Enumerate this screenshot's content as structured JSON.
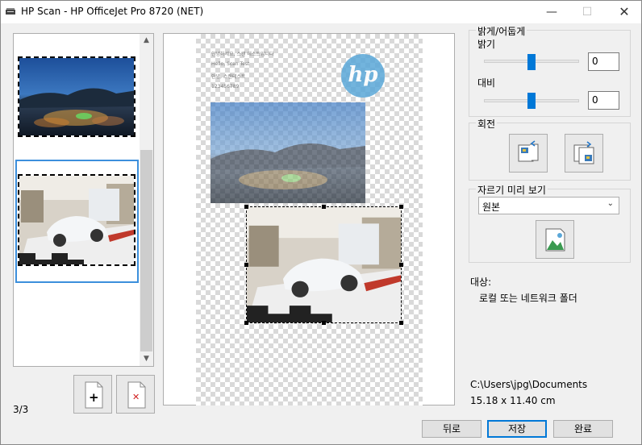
{
  "window": {
    "title": "HP Scan - HP OfficeJet Pro 8720 (NET)",
    "controls": {
      "minimize": "—",
      "maximize": "☐",
      "close": "✕"
    }
  },
  "thumbnails": {
    "items": [
      {
        "label": "night city landscape scan",
        "selected": false
      },
      {
        "label": "car showroom scan",
        "selected": true
      }
    ],
    "scroll_up": "▲",
    "scroll_down": "▼",
    "add_page_glyph": "+",
    "delete_page_glyph": "✕",
    "page_counter": "3/3"
  },
  "preview": {
    "page_text_lines": [
      "안녕하세요, 스캔 테스트입니다",
      "Hello, Scan Test",
      "안녕, 스캔테스트",
      "123456789"
    ],
    "logo_text": "hp"
  },
  "adjust": {
    "group_label": "밝게/어둡게",
    "brightness_label": "밝기",
    "brightness_value": "0",
    "contrast_label": "대비",
    "contrast_value": "0",
    "brightness_level": 0.5,
    "contrast_level": 0.5
  },
  "rotate": {
    "group_label": "회전"
  },
  "crop_preview": {
    "group_label": "자르기 미리 보기",
    "selected_option": "원본"
  },
  "destination": {
    "label": "대상:",
    "value": "로컬 또는 네트워크 폴더",
    "path": "C:\\Users\\jpg\\Documents",
    "size": "15.18 x 11.40 cm"
  },
  "footer": {
    "back_label": "뒤로",
    "save_label": "저장",
    "done_label": "완료"
  },
  "colors": {
    "accent": "#0078d7",
    "selection": "#3c8fdc",
    "hp_logo": "#5aa7d8"
  }
}
